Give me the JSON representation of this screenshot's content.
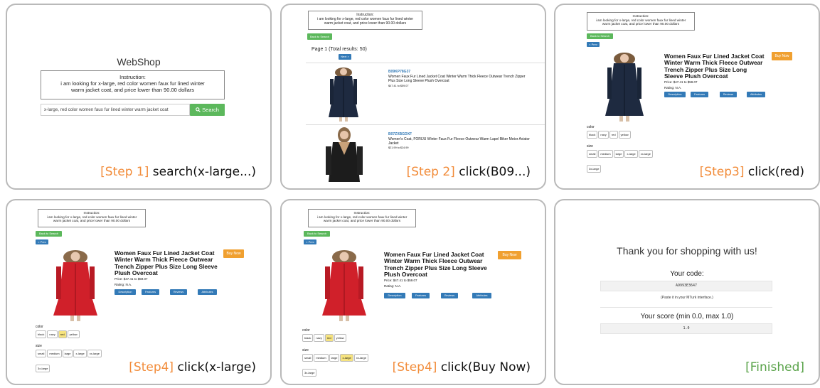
{
  "instruction_title": "Instruction:",
  "instruction_line1": "i am looking for x-large, red color women faux fur lined winter",
  "instruction_line2": "warm jacket coat, and price lower than 90.00 dollars",
  "p1": {
    "brand": "WebShop",
    "search_value": "x-large, red color women faux fur lined winter warm jacket coat",
    "search_button": "Search",
    "search_icon": "magnifier-icon",
    "caption_tag": "[Step 1]",
    "caption_action": "search(x-large...)"
  },
  "p2": {
    "back": "Back to Search",
    "page_info": "Page 1 (Total results: 50)",
    "next": "Next >",
    "r1_asin": "B09KP78G37",
    "r1_title": "Women Faux Fur Lined Jacket Coat Winter Warm Thick Fleece Outwear Trench Zipper Plus Size Long Sleeve Plush Overcoat",
    "r1_price": "$47.41 to $59.07",
    "r2_asin": "B07ZXBGDXF",
    "r2_title": "Women's Coat, FORIJU Winter Faux Fur Fleece Outwear Warm Lapel Biker Motor Aviator Jacket",
    "r2_price": "$21.99 to $24.99",
    "caption_tag": "[Step 2]",
    "caption_action": "click(B09...)"
  },
  "product": {
    "back": "Back to Search",
    "prev": "< Prev",
    "title": "Women Faux Fur Lined Jacket Coat Winter Warm Thick Fleece Outwear Trench Zipper Plus Size Long Sleeve Plush Overcoat",
    "price": "Price: $47.41 to $59.07",
    "rating": "Rating: N.A.",
    "buy": "Buy Now",
    "tab_description": "Description",
    "tab_features": "Features",
    "tab_reviews": "Reviews",
    "tab_attributes": "Attributes",
    "color_label": "color",
    "size_label": "size",
    "colors": [
      "black",
      "navy",
      "red",
      "yellow"
    ],
    "sizes": [
      "small",
      "medium",
      "large",
      "x-large",
      "xx-large",
      "3x-large"
    ]
  },
  "p3": {
    "caption_tag": "[Step3]",
    "caption_action": "click(red)"
  },
  "p4": {
    "caption_tag": "[Step4]",
    "caption_action": "click(x-large)"
  },
  "p5": {
    "caption_tag": "[Step4]",
    "caption_action": "click(Buy Now)"
  },
  "p6": {
    "thanks": "Thank you for shopping with us!",
    "code_label": "Your code:",
    "code": "A9993E3647",
    "paste": "(Paste it in your MTurk interface.)",
    "score_label": "Your score (min 0.0, max 1.0)",
    "score": "1.0",
    "caption_tag": "[Finished]"
  },
  "colors_hex": {
    "green": "#5cb85c",
    "blue": "#337ab7",
    "orange": "#f0a030",
    "selected": "#f6e37f",
    "caption_orange": "#f28c3a",
    "caption_green": "#5aa34a"
  }
}
